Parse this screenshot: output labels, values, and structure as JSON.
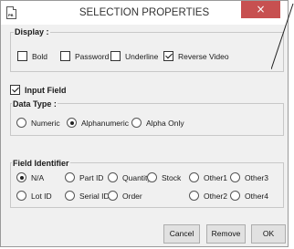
{
  "window": {
    "title": "SELECTION PROPERTIES",
    "app_icon_text": "PB",
    "close_glyph": "×"
  },
  "display": {
    "label": "Display :",
    "options": [
      {
        "label": "Bold",
        "checked": false
      },
      {
        "label": "Password",
        "checked": false
      },
      {
        "label": "Underline",
        "checked": false
      },
      {
        "label": "Reverse Video",
        "checked": true
      }
    ]
  },
  "input_field": {
    "label": "Input Field",
    "checked": true
  },
  "data_type": {
    "label": "Data Type :",
    "options": [
      {
        "label": "Numeric",
        "selected": false
      },
      {
        "label": "Alphanumeric",
        "selected": true
      },
      {
        "label": "Alpha Only",
        "selected": false
      }
    ]
  },
  "field_identifier": {
    "label": "Field Identifier",
    "options": [
      {
        "label": "N/A",
        "selected": true
      },
      {
        "label": "Part ID",
        "selected": false
      },
      {
        "label": "Quantity",
        "selected": false
      },
      {
        "label": "Stock",
        "selected": false
      },
      {
        "label": "Other1",
        "selected": false
      },
      {
        "label": "Other3",
        "selected": false
      },
      {
        "label": "Lot ID",
        "selected": false
      },
      {
        "label": "Serial ID",
        "selected": false
      },
      {
        "label": "Order",
        "selected": false
      },
      {
        "label": "Other2",
        "selected": false
      },
      {
        "label": "Other4",
        "selected": false
      }
    ]
  },
  "buttons": {
    "cancel": "Cancel",
    "remove": "Remove",
    "ok": "OK"
  },
  "colors": {
    "close_button": "#c75050",
    "background": "#f0f0f0"
  }
}
